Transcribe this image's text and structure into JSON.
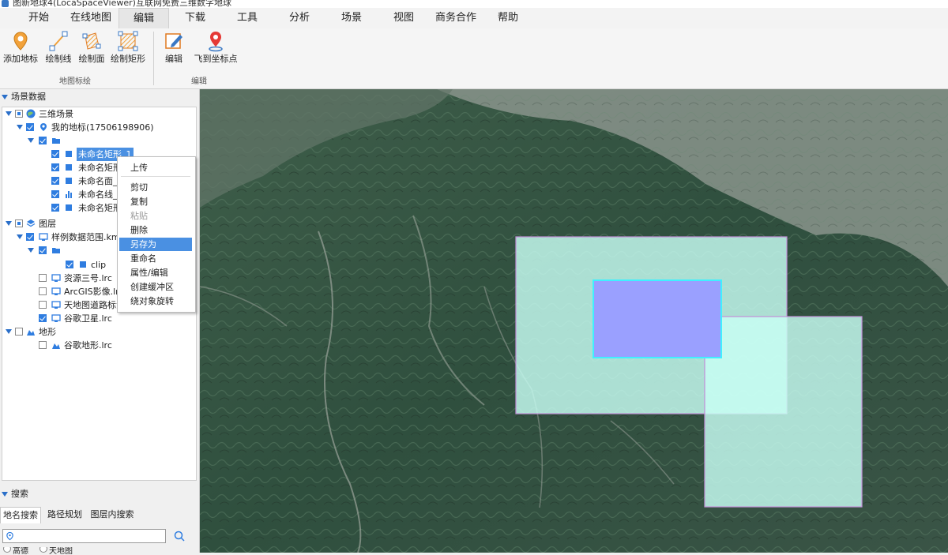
{
  "window": {
    "title": "图新地球4(LocaSpaceViewer)互联网免费三维数字地球"
  },
  "menu": {
    "items": [
      "开始",
      "在线地图",
      "编辑",
      "下载",
      "工具",
      "分析",
      "场景",
      "视图",
      "商务合作",
      "帮助"
    ],
    "active_index": 2
  },
  "ribbon": {
    "groups": [
      {
        "label": "地图标绘",
        "buttons": [
          "添加地标",
          "绘制线",
          "绘制面",
          "绘制矩形"
        ]
      },
      {
        "label": "编辑",
        "buttons": [
          "编辑",
          "飞到坐标点"
        ]
      }
    ]
  },
  "scene_panel": {
    "title": "场景数据",
    "tree": [
      {
        "label": "三维场景"
      },
      {
        "label": "我的地标(17506198906)"
      },
      {
        "label": ""
      },
      {
        "label": "未命名矩形_1",
        "selected": true
      },
      {
        "label": "未命名矩形"
      },
      {
        "label": "未命名面_1"
      },
      {
        "label": "未命名线_1"
      },
      {
        "label": "未命名矩形"
      },
      {
        "label": "图层"
      },
      {
        "label": "样例数据范围.kml"
      },
      {
        "label": ""
      },
      {
        "label": "clip"
      },
      {
        "label": "资源三号.lrc"
      },
      {
        "label": "ArcGIS影像.lrc"
      },
      {
        "label": "天地图道路标注"
      },
      {
        "label": "谷歌卫星.lrc"
      },
      {
        "label": "地形"
      },
      {
        "label": "谷歌地形.lrc"
      }
    ]
  },
  "context_menu": {
    "items": [
      "上传",
      "剪切",
      "复制",
      "粘贴",
      "删除",
      "另存为",
      "重命名",
      "属性/编辑",
      "创建缓冲区",
      "绕对象旋转"
    ],
    "disabled": [
      "粘贴"
    ],
    "highlighted": "另存为"
  },
  "search_panel": {
    "title": "搜索",
    "tabs": [
      "地名搜索",
      "路径规划",
      "图层内搜索"
    ],
    "active_tab": 0,
    "input_value": "",
    "radios": [
      "高德",
      "天地图"
    ]
  },
  "colors": {
    "accent": "#2f7de0",
    "highlight": "#4a90e2",
    "polygon_fill": "#c8fff4",
    "rect_fill": "#9aa0ff",
    "rect_border": "#3ff0ff"
  }
}
